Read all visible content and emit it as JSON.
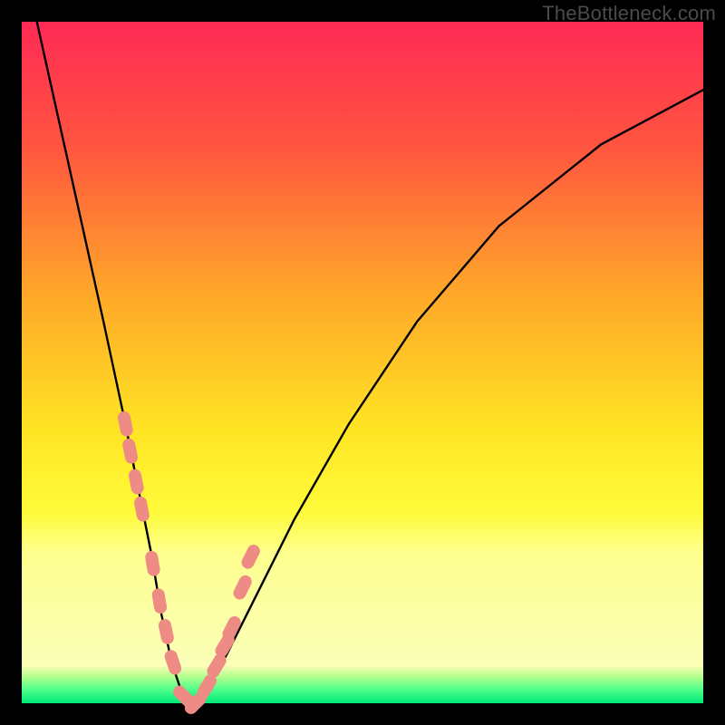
{
  "watermark": "TheBottleneck.com",
  "colors": {
    "frame": "#000000",
    "gradient_stops": [
      {
        "pct": 0,
        "color": "#ff2a55"
      },
      {
        "pct": 18,
        "color": "#ff5440"
      },
      {
        "pct": 40,
        "color": "#ffa829"
      },
      {
        "pct": 60,
        "color": "#ffe524"
      },
      {
        "pct": 72,
        "color": "#fffb3a"
      },
      {
        "pct": 78,
        "color": "#fdff8f"
      },
      {
        "pct": 94.5,
        "color": "#fbffb8"
      },
      {
        "pct": 96,
        "color": "#b8ff8e"
      },
      {
        "pct": 98,
        "color": "#4dff8a"
      },
      {
        "pct": 100,
        "color": "#00e87a"
      }
    ],
    "curve": "#000000",
    "marker_fill": "#ef8b85",
    "marker_stroke": "#c86a63"
  },
  "chart_data": {
    "type": "line",
    "title": "",
    "xlabel": "",
    "ylabel": "",
    "xlim": [
      0,
      100
    ],
    "ylim": [
      0,
      100
    ],
    "series": [
      {
        "name": "bottleneck-curve",
        "x": [
          0,
          4,
          8,
          12,
          15,
          17,
          19,
          20.5,
          22,
          23.5,
          25,
          27,
          30,
          34,
          40,
          48,
          58,
          70,
          85,
          100
        ],
        "values": [
          110,
          92,
          74,
          56,
          42,
          32,
          22,
          13,
          6,
          1.5,
          0,
          2,
          7,
          15,
          27,
          41,
          56,
          70,
          82,
          90
        ]
      }
    ],
    "markers": {
      "name": "highlighted-points",
      "shape": "pill",
      "x": [
        15.2,
        15.9,
        16.8,
        17.6,
        19.2,
        20.2,
        21.2,
        22.2,
        23.8,
        25.5,
        27.2,
        28.6,
        29.8,
        30.8,
        32.4,
        33.6
      ],
      "values": [
        41.0,
        37.0,
        32.5,
        28.5,
        20.5,
        15.0,
        10.5,
        6.0,
        1.0,
        0.0,
        2.5,
        5.5,
        8.5,
        11.0,
        17.0,
        21.5
      ]
    }
  }
}
